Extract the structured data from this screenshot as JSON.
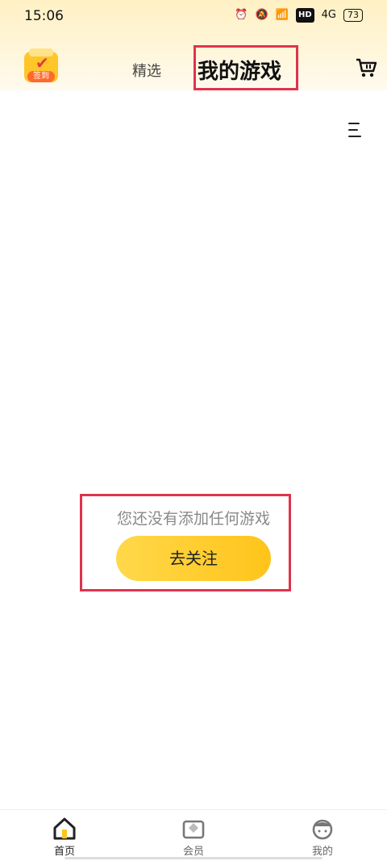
{
  "status_bar": {
    "time": "15:06",
    "network_label": "4G",
    "hd_label": "HD",
    "battery": "73"
  },
  "header": {
    "signin_label": "签到",
    "tabs": [
      {
        "label": "精选",
        "active": false
      },
      {
        "label": "我的游戏",
        "active": true
      }
    ]
  },
  "main": {
    "empty_message": "您还没有添加任何游戏",
    "follow_button_label": "去关注"
  },
  "bottom_nav": {
    "items": [
      {
        "label": "首页",
        "icon": "home-icon",
        "active": true
      },
      {
        "label": "会员",
        "icon": "vip-icon",
        "active": false
      },
      {
        "label": "我的",
        "icon": "profile-icon",
        "active": false
      }
    ]
  },
  "colors": {
    "accent_yellow": "#ffc41a",
    "highlight_red": "#e0334b",
    "header_bg": "#fff1c4"
  }
}
